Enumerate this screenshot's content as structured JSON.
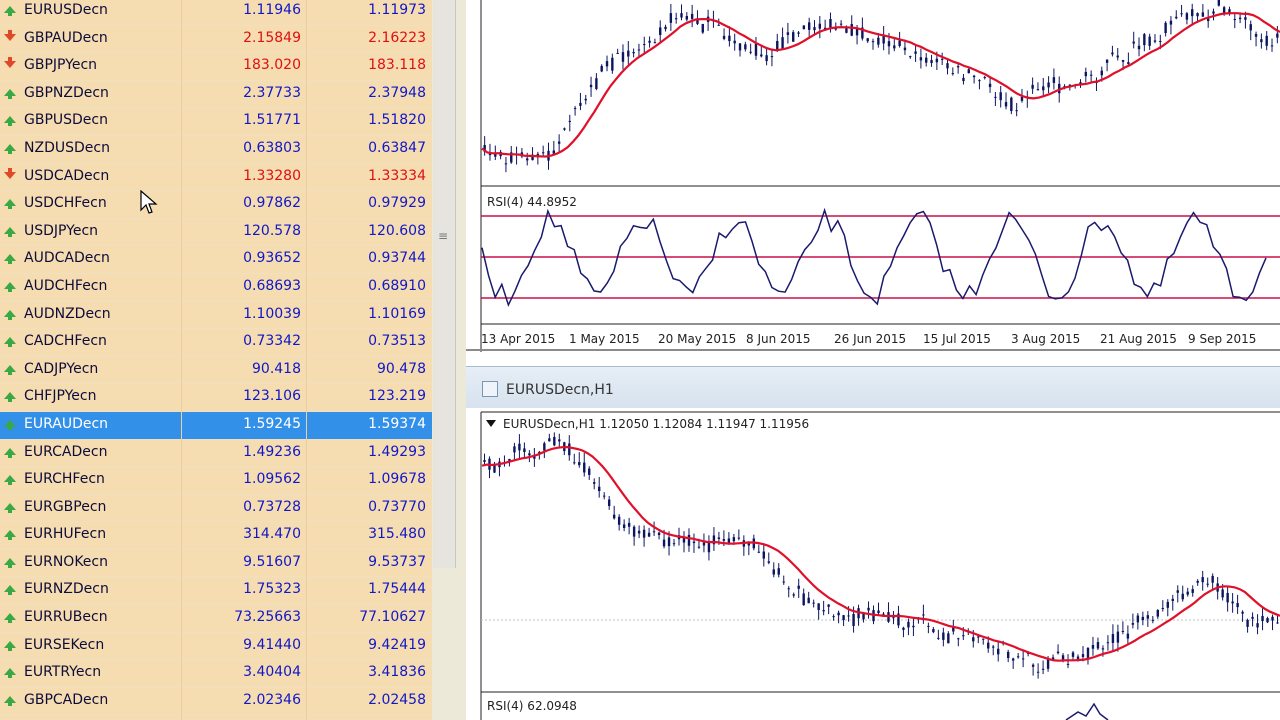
{
  "market_watch": {
    "rows": [
      {
        "symbol": "EURUSDecn",
        "bid": "1.11946",
        "ask": "1.11973",
        "dir": "up"
      },
      {
        "symbol": "GBPAUDecn",
        "bid": "2.15849",
        "ask": "2.16223",
        "dir": "down"
      },
      {
        "symbol": "GBPJPYecn",
        "bid": "183.020",
        "ask": "183.118",
        "dir": "down"
      },
      {
        "symbol": "GBPNZDecn",
        "bid": "2.37733",
        "ask": "2.37948",
        "dir": "up"
      },
      {
        "symbol": "GBPUSDecn",
        "bid": "1.51771",
        "ask": "1.51820",
        "dir": "up"
      },
      {
        "symbol": "NZDUSDecn",
        "bid": "0.63803",
        "ask": "0.63847",
        "dir": "up"
      },
      {
        "symbol": "USDCADecn",
        "bid": "1.33280",
        "ask": "1.33334",
        "dir": "down"
      },
      {
        "symbol": "USDCHFecn",
        "bid": "0.97862",
        "ask": "0.97929",
        "dir": "up"
      },
      {
        "symbol": "USDJPYecn",
        "bid": "120.578",
        "ask": "120.608",
        "dir": "up"
      },
      {
        "symbol": "AUDCADecn",
        "bid": "0.93652",
        "ask": "0.93744",
        "dir": "up"
      },
      {
        "symbol": "AUDCHFecn",
        "bid": "0.68693",
        "ask": "0.68910",
        "dir": "up"
      },
      {
        "symbol": "AUDNZDecn",
        "bid": "1.10039",
        "ask": "1.10169",
        "dir": "up"
      },
      {
        "symbol": "CADCHFecn",
        "bid": "0.73342",
        "ask": "0.73513",
        "dir": "up"
      },
      {
        "symbol": "CADJPYecn",
        "bid": "90.418",
        "ask": "90.478",
        "dir": "up"
      },
      {
        "symbol": "CHFJPYecn",
        "bid": "123.106",
        "ask": "123.219",
        "dir": "up"
      },
      {
        "symbol": "EURAUDecn",
        "bid": "1.59245",
        "ask": "1.59374",
        "dir": "up",
        "selected": true
      },
      {
        "symbol": "EURCADecn",
        "bid": "1.49236",
        "ask": "1.49293",
        "dir": "up"
      },
      {
        "symbol": "EURCHFecn",
        "bid": "1.09562",
        "ask": "1.09678",
        "dir": "up"
      },
      {
        "symbol": "EURGBPecn",
        "bid": "0.73728",
        "ask": "0.73770",
        "dir": "up"
      },
      {
        "symbol": "EURHUFecn",
        "bid": "314.470",
        "ask": "315.480",
        "dir": "up"
      },
      {
        "symbol": "EURNOKecn",
        "bid": "9.51607",
        "ask": "9.53737",
        "dir": "up"
      },
      {
        "symbol": "EURNZDecn",
        "bid": "1.75323",
        "ask": "1.75444",
        "dir": "up"
      },
      {
        "symbol": "EURRUBecn",
        "bid": "73.25663",
        "ask": "77.10627",
        "dir": "up"
      },
      {
        "symbol": "EURSEKecn",
        "bid": "9.41440",
        "ask": "9.42419",
        "dir": "up"
      },
      {
        "symbol": "EURTRYecn",
        "bid": "3.40404",
        "ask": "3.41836",
        "dir": "up"
      },
      {
        "symbol": "GBPCADecn",
        "bid": "2.02346",
        "ask": "2.02458",
        "dir": "up"
      }
    ]
  },
  "top_chart": {
    "rsi_label": "RSI(4) 44.8952",
    "dates": [
      "13 Apr 2015",
      "1 May 2015",
      "20 May 2015",
      "8 Jun 2015",
      "26 Jun 2015",
      "15 Jul 2015",
      "3 Aug 2015",
      "21 Aug 2015",
      "9 Sep 2015"
    ]
  },
  "bottom_chart": {
    "window_title": "EURUSDecn,H1",
    "header": "EURUSDecn,H1  1.12050 1.12084 1.11947 1.11956",
    "rsi_label": "RSI(4) 62.0948"
  },
  "colors": {
    "panel": "#f6dcb1",
    "selected": "#3390e8",
    "up_price": "#1018c8",
    "down_price": "#e01010",
    "ma": "#e0102a",
    "rsi_line": "#1a1a6e",
    "candle": "#0c1660"
  },
  "icons": [
    "arrow-up-icon",
    "arrow-down-icon",
    "chart-window-icon",
    "mouse-pointer-icon",
    "grip-icon"
  ]
}
